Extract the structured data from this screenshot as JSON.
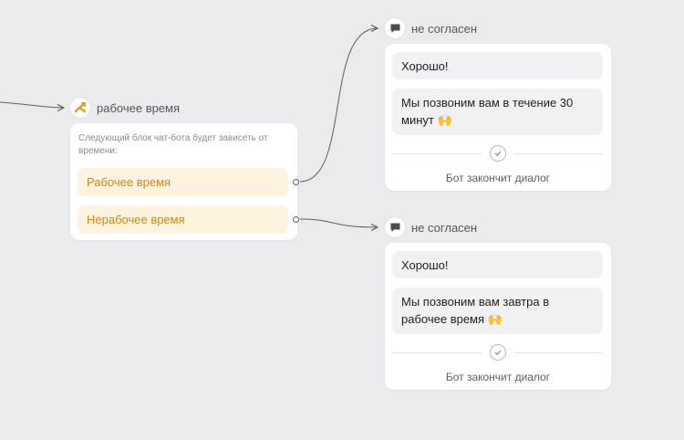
{
  "router_node": {
    "title": "рабочее время",
    "description": "Следующий блок чат-бота будет зависеть от времени:",
    "options": [
      {
        "label": "Рабочее время"
      },
      {
        "label": "Нерабочее время"
      }
    ],
    "icon": "branch-icon",
    "accent_color": "#c98a14"
  },
  "message_nodes": [
    {
      "title": "не согласен",
      "icon": "chat-bubble-icon",
      "messages": [
        {
          "text": "Хорошо!"
        },
        {
          "text": "Мы позвоним вам в течение 30 минут",
          "emoji": "🙌"
        }
      ],
      "end_label": "Бот закончит диалог"
    },
    {
      "title": "не согласен",
      "icon": "chat-bubble-icon",
      "messages": [
        {
          "text": "Хорошо!"
        },
        {
          "text": "Мы позвоним вам завтра в рабочее время",
          "emoji": "🙌"
        }
      ],
      "end_label": "Бот закончит диалог"
    }
  ],
  "colors": {
    "canvas_bg": "#ebebee",
    "option_bg": "#fdf3de",
    "message_bg": "#f1f1f3",
    "connector": "#5d5e63"
  }
}
